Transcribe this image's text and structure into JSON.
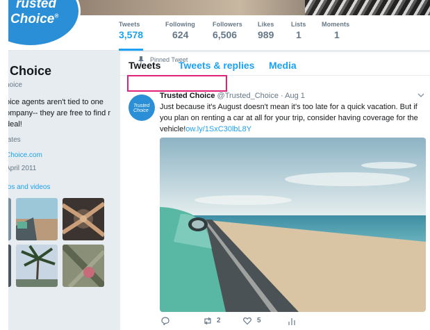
{
  "profile": {
    "logo_line1": "rusted",
    "logo_line2": "Choice",
    "logo_mark": "®",
    "name": "l Choice",
    "handle": "hoice",
    "bio": "oice agents aren't tied to one ompany-- they are free to find r deal!",
    "location": "tates",
    "url": "Choice.com",
    "joined": "April 2011",
    "photos_label": "tos and videos"
  },
  "stats": [
    {
      "label": "Tweets",
      "value": "3,578"
    },
    {
      "label": "Following",
      "value": "624"
    },
    {
      "label": "Followers",
      "value": "6,506"
    },
    {
      "label": "Likes",
      "value": "989"
    },
    {
      "label": "Lists",
      "value": "1"
    },
    {
      "label": "Moments",
      "value": "1"
    }
  ],
  "tabs": {
    "tweets": "Tweets",
    "replies": "Tweets & replies",
    "media": "Media"
  },
  "pinned_label": "Pinned Tweet",
  "tweet": {
    "author": "Trusted Choice",
    "handle": "@Trusted_Choice",
    "separator": " · ",
    "date": "Aug 1",
    "text": "Just because it's August doesn't mean it's too late for a quick vacation. But if you plan on renting a car at all for your trip, consider having coverage for the vehicle!",
    "link": "ow.ly/1SxC30lbL8Y",
    "retweets": "2",
    "likes": "5"
  },
  "icons": [
    "pin-icon",
    "reply-icon",
    "retweet-icon",
    "like-icon",
    "analytics-icon",
    "chevron-down-icon"
  ],
  "colors": {
    "accent": "#1da1f2",
    "highlight": "#e0237a",
    "brand": "#2a8fd6"
  }
}
